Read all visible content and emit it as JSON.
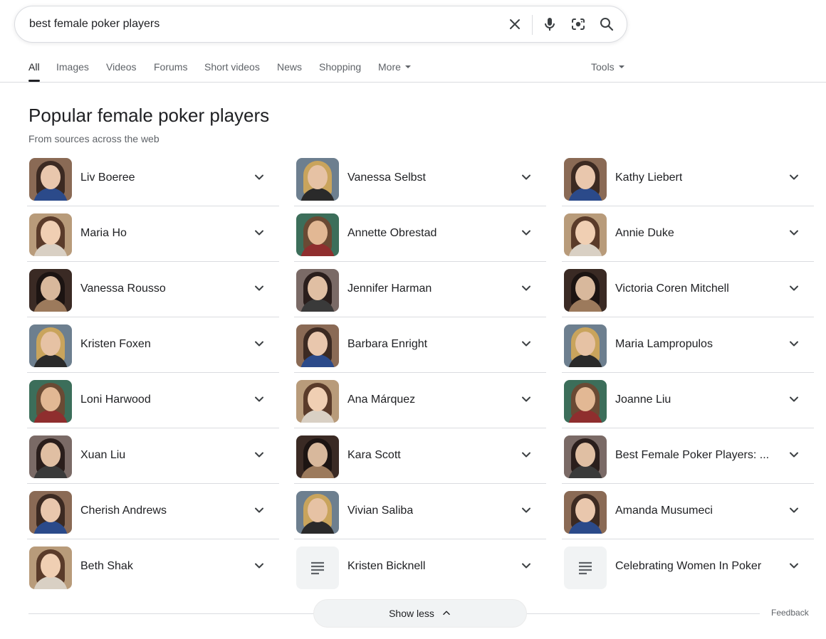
{
  "search": {
    "query": "best female poker players",
    "clear_icon": "close-icon",
    "voice_icon": "microphone-icon",
    "lens_icon": "camera-lens-icon",
    "search_icon": "search-icon"
  },
  "tabs": {
    "items": [
      {
        "label": "All",
        "active": true
      },
      {
        "label": "Images"
      },
      {
        "label": "Videos"
      },
      {
        "label": "Forums"
      },
      {
        "label": "Short videos"
      },
      {
        "label": "News"
      },
      {
        "label": "Shopping"
      },
      {
        "label": "More"
      }
    ],
    "tools_label": "Tools"
  },
  "panel": {
    "title": "Popular female poker players",
    "subtitle": "From sources across the web"
  },
  "columns": [
    [
      {
        "name": "Liv Boeree"
      },
      {
        "name": "Maria Ho"
      },
      {
        "name": "Vanessa Rousso"
      },
      {
        "name": "Kristen Foxen"
      },
      {
        "name": "Loni Harwood"
      },
      {
        "name": "Xuan Liu"
      },
      {
        "name": "Cherish Andrews"
      },
      {
        "name": "Beth Shak"
      }
    ],
    [
      {
        "name": "Vanessa Selbst"
      },
      {
        "name": "Annette Obrestad"
      },
      {
        "name": "Jennifer Harman"
      },
      {
        "name": "Barbara Enright"
      },
      {
        "name": "Ana Márquez"
      },
      {
        "name": "Kara Scott"
      },
      {
        "name": "Vivian Saliba"
      },
      {
        "name": "Kristen Bicknell",
        "icon": "document-icon"
      }
    ],
    [
      {
        "name": "Kathy Liebert"
      },
      {
        "name": "Annie Duke"
      },
      {
        "name": "Victoria Coren Mitchell"
      },
      {
        "name": "Maria Lampropulos"
      },
      {
        "name": "Joanne Liu"
      },
      {
        "name": "Best Female Poker Players: ..."
      },
      {
        "name": "Amanda Musumeci"
      },
      {
        "name": "Celebrating Women In Poker",
        "icon": "document-icon"
      }
    ]
  ],
  "footer": {
    "show_less_label": "Show less",
    "feedback_label": "Feedback"
  },
  "colors": {
    "text": "#202124",
    "secondary_text": "#5f6368",
    "divider": "#dadce0",
    "button_bg": "#f1f3f4"
  }
}
